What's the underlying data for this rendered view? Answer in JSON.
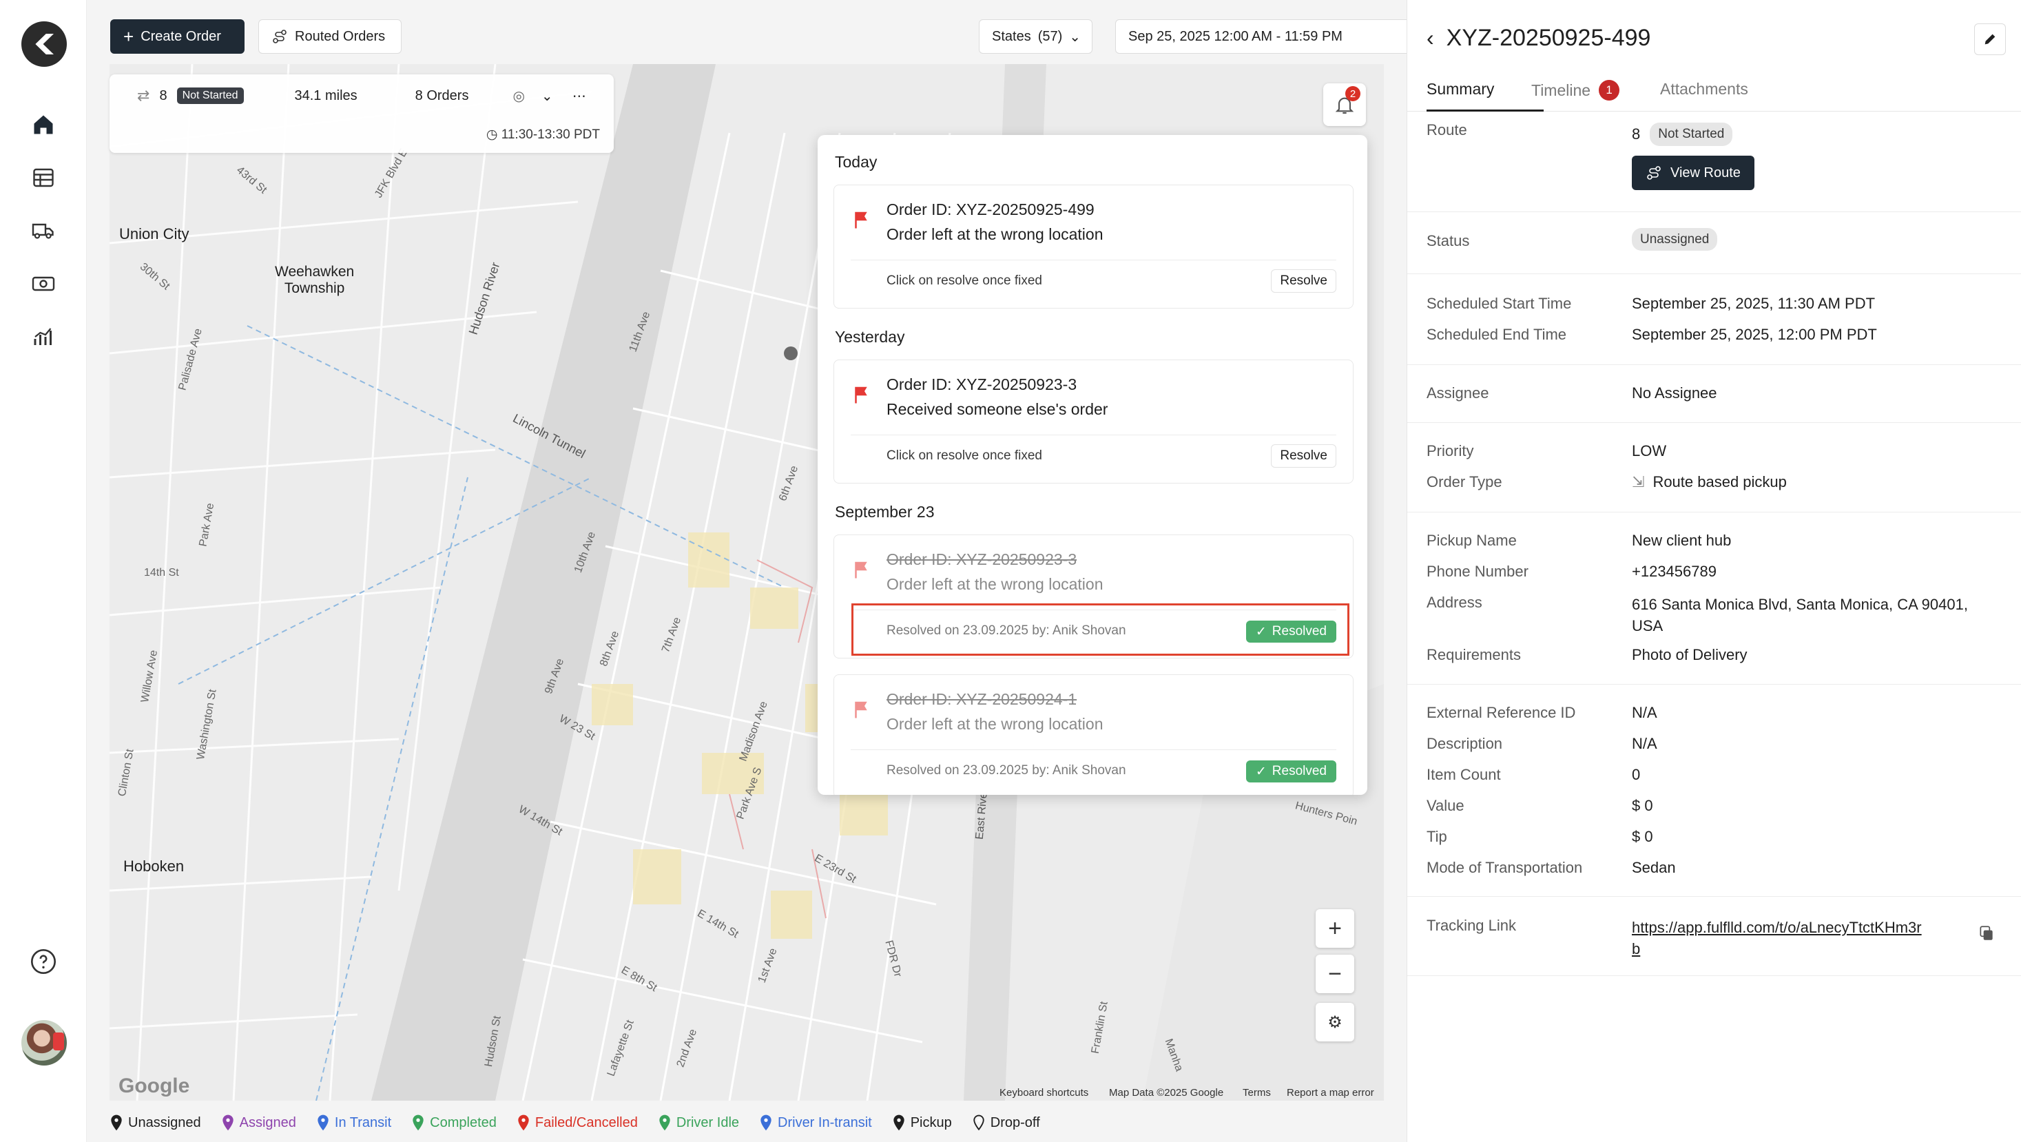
{
  "toolbar": {
    "create_order": "Create Order",
    "routed_orders": "Routed Orders",
    "states_label": "States",
    "states_count": "(57)",
    "date_range": "Sep 25, 2025 12:00 AM - 11:59 PM"
  },
  "route_card": {
    "route_no": "8",
    "status": "Not Started",
    "distance": "34.1 miles",
    "orders": "8 Orders",
    "time_window": "11:30-13:30 PDT"
  },
  "notifications": {
    "unread_count": "2",
    "sections": [
      {
        "title": "Today"
      },
      {
        "title": "Yesterday"
      },
      {
        "title": "September 23"
      }
    ],
    "items": [
      {
        "order": "Order ID: XYZ-20250925-499",
        "message": "Order left at the wrong location",
        "hint": "Click on resolve once fixed",
        "action": "Resolve"
      },
      {
        "order": "Order ID: XYZ-20250923-3",
        "message": "Received someone else's order",
        "hint": "Click on resolve once fixed",
        "action": "Resolve"
      },
      {
        "order": "Order ID: XYZ-20250923-3",
        "message": "Order left at the wrong location",
        "hint": "Resolved on 23.09.2025 by: Anik Shovan",
        "action": "Resolved"
      },
      {
        "order": "Order ID: XYZ-20250924-1",
        "message": "Order left at the wrong location",
        "hint": "Resolved on 23.09.2025 by: Anik Shovan",
        "action": "Resolved"
      }
    ]
  },
  "map": {
    "labels": [
      "Union City",
      "Weehawken",
      "Township",
      "Hoboken",
      "Hudson River",
      "Lincoln Tunnel",
      "43rd St",
      "30th St",
      "14th St",
      "Palisade Ave",
      "Park Ave",
      "Willow Ave",
      "Washington St",
      "Clinton St",
      "JFK Blvd E",
      "11th Ave",
      "10th Ave",
      "9th Ave",
      "8th Ave",
      "7th Ave",
      "6th Ave",
      "Madison Ave",
      "Park Ave S",
      "W 23 St",
      "W 14th St",
      "E 23rd St",
      "E 14th St",
      "E 8th St",
      "1st Ave",
      "2nd Ave",
      "Lafayette St",
      "Hudson St",
      "FDR Dr",
      "East River",
      "Franklin St",
      "Hunters Poin",
      "Manha"
    ],
    "footer": [
      "Keyboard shortcuts",
      "Map Data ©2025 Google",
      "Terms",
      "Report a map error"
    ],
    "google": "Google"
  },
  "legend": [
    {
      "label": "Unassigned",
      "color": "#1f1f1f"
    },
    {
      "label": "Assigned",
      "color": "#8e44ad"
    },
    {
      "label": "In Transit",
      "color": "#3b6fd8"
    },
    {
      "label": "Completed",
      "color": "#3aa35b"
    },
    {
      "label": "Failed/Cancelled",
      "color": "#d93025"
    },
    {
      "label": "Driver Idle",
      "color": "#3aa35b"
    },
    {
      "label": "Driver In-transit",
      "color": "#3b6fd8"
    },
    {
      "label": "Pickup",
      "color": "#1f1f1f"
    },
    {
      "label": "Drop-off",
      "color": "#1f1f1f"
    }
  ],
  "detail": {
    "title": "XYZ-20250925-499",
    "tabs": {
      "summary": "Summary",
      "timeline": "Timeline",
      "timeline_count": "1",
      "attachments": "Attachments"
    },
    "route_label": "Route",
    "route_no": "8",
    "route_status": "Not Started",
    "view_route": "View Route",
    "status_label": "Status",
    "status_value": "Unassigned",
    "start_label": "Scheduled Start Time",
    "start_value": "September 25, 2025, 11:30 AM PDT",
    "end_label": "Scheduled End Time",
    "end_value": "September 25, 2025, 12:00 PM PDT",
    "assignee_label": "Assignee",
    "assignee_value": "No Assignee",
    "priority_label": "Priority",
    "priority_value": "LOW",
    "order_type_label": "Order Type",
    "order_type_value": "Route based pickup",
    "pickup_name_label": "Pickup Name",
    "pickup_name_value": "New client hub",
    "phone_label": "Phone Number",
    "phone_value": "+123456789",
    "address_label": "Address",
    "address_line1": "616 Santa Monica Blvd, Santa Monica, CA 90401,",
    "address_line2": "USA",
    "requirements_label": "Requirements",
    "requirements_value": "Photo of Delivery",
    "extref_label": "External Reference ID",
    "extref_value": "N/A",
    "description_label": "Description",
    "description_value": "N/A",
    "item_count_label": "Item Count",
    "item_count_value": "0",
    "value_label": "Value",
    "value_value": "$ 0",
    "tip_label": "Tip",
    "tip_value": "$ 0",
    "mode_label": "Mode of Transportation",
    "mode_value": "Sedan",
    "tracking_label": "Tracking Link",
    "tracking_line1": "https://app.fulflld.com/t/o/aLnecyTtctKHm3r",
    "tracking_line2": "b"
  }
}
